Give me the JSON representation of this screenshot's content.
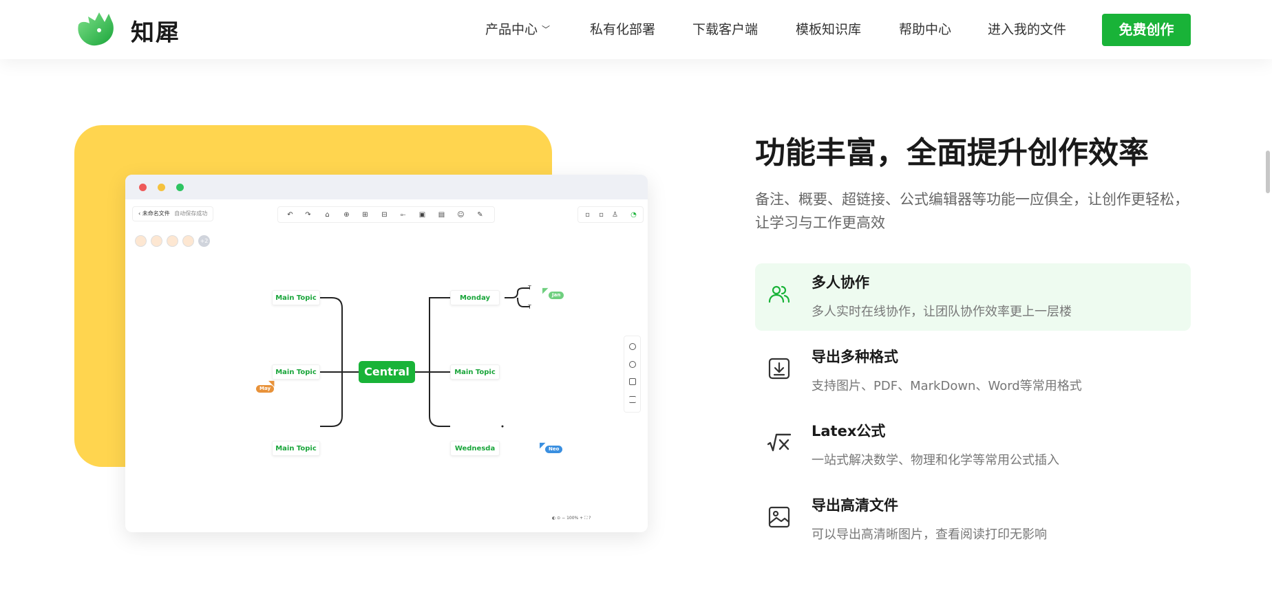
{
  "header": {
    "brand": "知犀",
    "nav": [
      "产品中心",
      "私有化部署",
      "下载客户端",
      "模板知识库",
      "帮助中心",
      "进入我的文件"
    ],
    "cta": "免费创作"
  },
  "illustration": {
    "file_name": "未命名文件",
    "save_status": "自动保存成功",
    "avatar_more": "+2",
    "central": "Central",
    "left_topics": [
      "Main Topic",
      "Main Topic",
      "Main Topic"
    ],
    "right_topics": [
      "Monday",
      "Main Topic",
      "Wednesda"
    ],
    "leaves": [
      "T",
      "T"
    ],
    "cursor_tags": [
      {
        "name": "Jan",
        "color": "#6fcf7f"
      },
      {
        "name": "May",
        "color": "#e8923a"
      },
      {
        "name": "Neo",
        "color": "#3a8fe0"
      }
    ],
    "zoom": "100%",
    "colors": {
      "yellow": "#ffd54f",
      "green": "#19b338"
    }
  },
  "content": {
    "title": "功能丰富，全面提升创作效率",
    "description": "备注、概要、超链接、公式编辑器等功能一应俱全，让创作更轻松，让学习与工作更高效",
    "features": [
      {
        "title": "多人协作",
        "desc": "多人实时在线协作，让团队协作效率更上一层楼",
        "icon": "users-icon"
      },
      {
        "title": "导出多种格式",
        "desc": "支持图片、PDF、MarkDown、Word等常用格式",
        "icon": "download-icon"
      },
      {
        "title": "Latex公式",
        "desc": "一站式解决数学、物理和化学等常用公式插入",
        "icon": "sqrt-x-icon"
      },
      {
        "title": "导出高清文件",
        "desc": "可以导出高清晰图片，查看阅读打印无影响",
        "icon": "image-icon"
      }
    ]
  }
}
